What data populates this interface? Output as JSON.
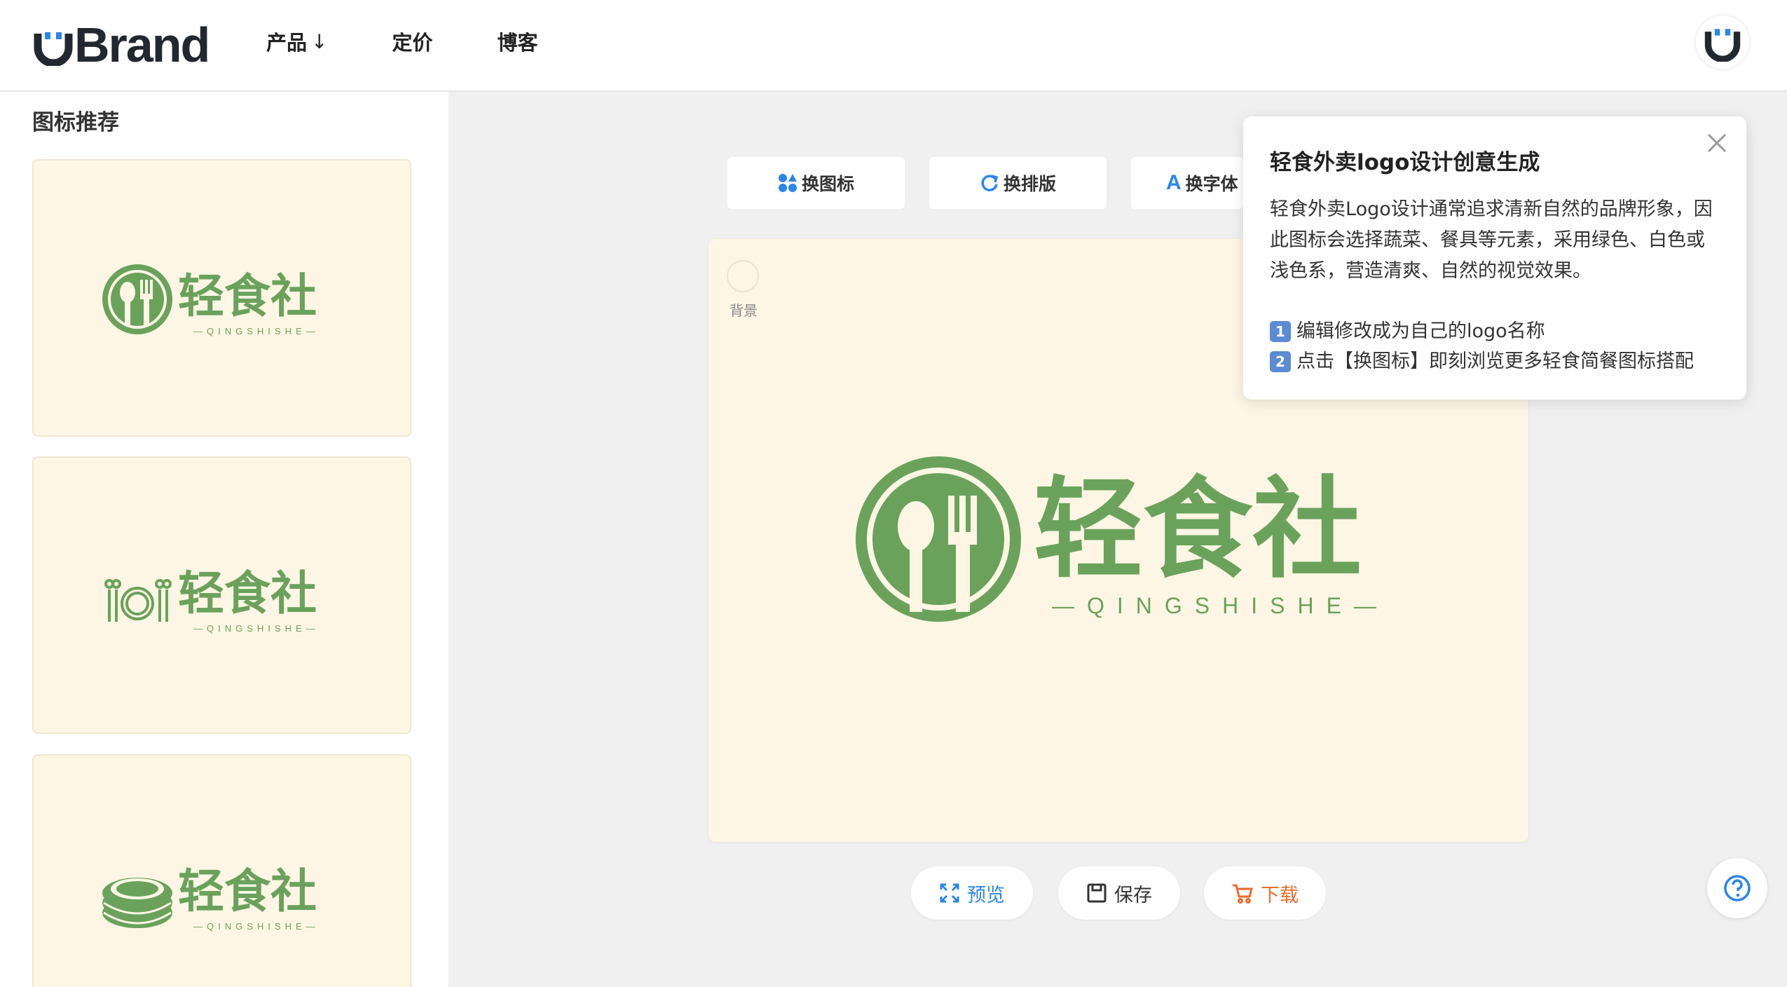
{
  "header": {
    "brand_name": "Brand",
    "nav": [
      {
        "label": "产品",
        "arrow": "↓"
      },
      {
        "label": "定价"
      },
      {
        "label": "博客"
      }
    ]
  },
  "sidebar": {
    "title": "图标推荐",
    "cards": [
      {
        "name": "轻食社",
        "pinyin": "—QINGSHISHE—",
        "icon": "spoon-fork-circle-icon"
      },
      {
        "name": "轻食社",
        "pinyin": "—QINGSHISHE—",
        "icon": "place-setting-icon"
      },
      {
        "name": "轻食社",
        "pinyin": "—QINGSHISHE—",
        "icon": "stacked-plates-icon"
      }
    ]
  },
  "toolbar": {
    "change_icon": "换图标",
    "change_layout": "换排版",
    "change_font": "换字体"
  },
  "canvas": {
    "background_label": "背景",
    "background_color": "#fdf6e4",
    "logo_name": "轻食社",
    "logo_pinyin": "—QINGSHISHE—",
    "logo_color": "#6aa25c"
  },
  "actions": {
    "preview": "预览",
    "save": "保存",
    "download": "下载"
  },
  "tip": {
    "title": "轻食外卖logo设计创意生成",
    "body": "轻食外卖Logo设计通常追求清新自然的品牌形象，因此图标会选择蔬菜、餐具等元素，采用绿色、白色或浅色系，营造清爽、自然的视觉效果。",
    "step1_num": "1",
    "step1": "编辑修改成为自己的logo名称",
    "step2_num": "2",
    "step2": "点击【换图标】即刻浏览更多轻食简餐图标搭配"
  },
  "colors": {
    "accent_blue": "#2a86e8",
    "download_orange": "#ee6a2b",
    "logo_green": "#6aa25c"
  }
}
